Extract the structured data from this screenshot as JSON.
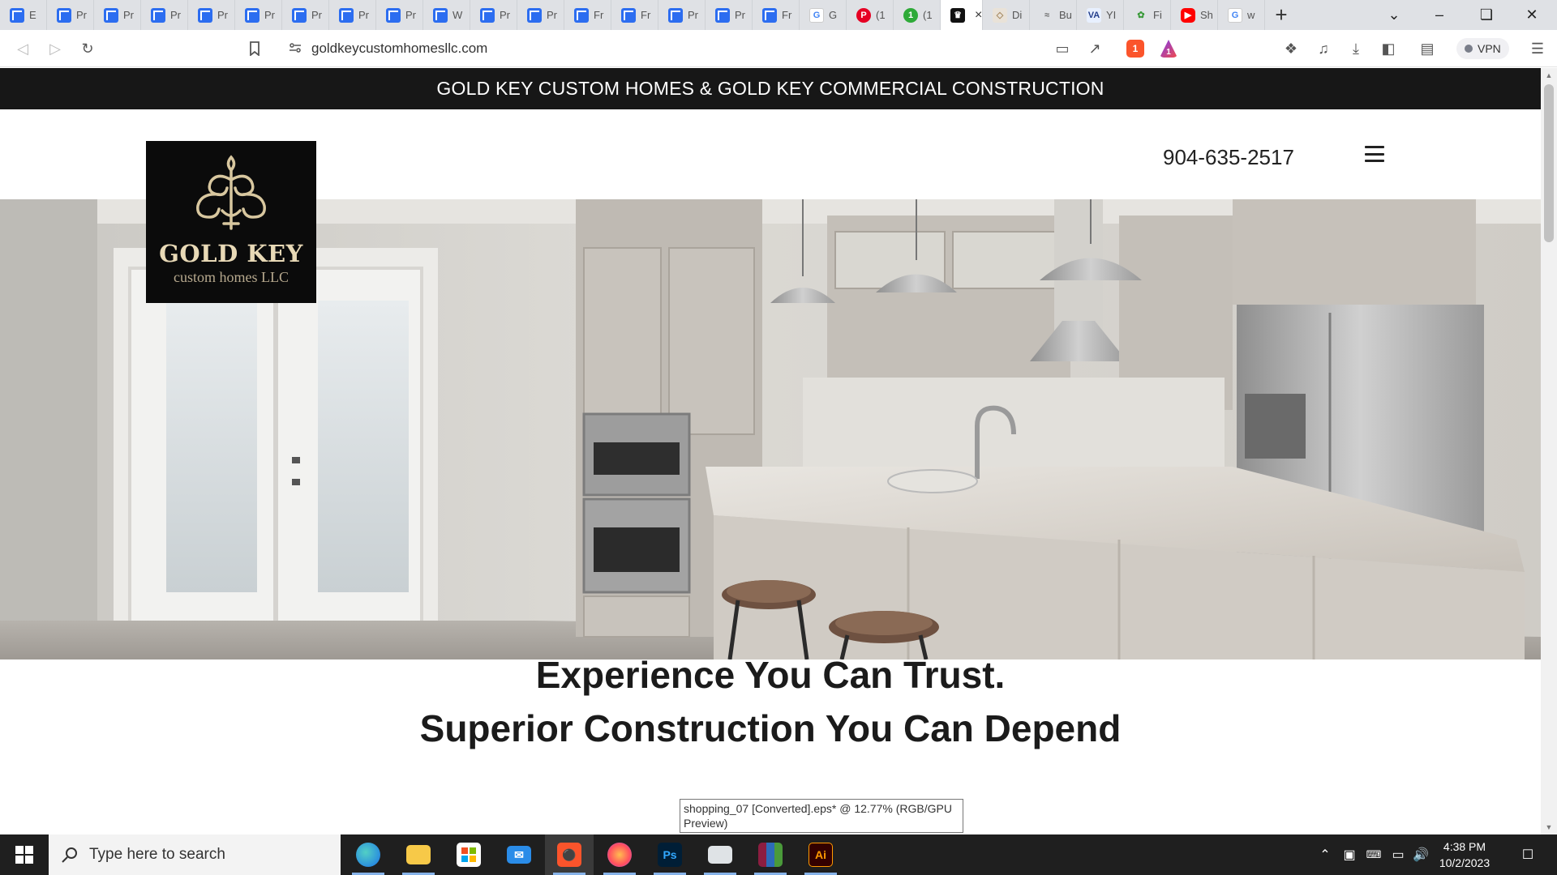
{
  "browser": {
    "tabs": [
      {
        "icon": "f",
        "label": "E"
      },
      {
        "icon": "f",
        "label": "Pr"
      },
      {
        "icon": "f",
        "label": "Pr"
      },
      {
        "icon": "f",
        "label": "Pr"
      },
      {
        "icon": "f",
        "label": "Pr"
      },
      {
        "icon": "f",
        "label": "Pr"
      },
      {
        "icon": "f",
        "label": "Pr"
      },
      {
        "icon": "f",
        "label": "Pr"
      },
      {
        "icon": "f",
        "label": "Pr"
      },
      {
        "icon": "f",
        "label": "W"
      },
      {
        "icon": "f",
        "label": "Pr"
      },
      {
        "icon": "f",
        "label": "Pr"
      },
      {
        "icon": "f",
        "label": "Fr"
      },
      {
        "icon": "f",
        "label": "Fr"
      },
      {
        "icon": "f",
        "label": "Pr"
      },
      {
        "icon": "f",
        "label": "Pr"
      },
      {
        "icon": "f",
        "label": "Fr"
      },
      {
        "icon": "g",
        "label": "G"
      },
      {
        "icon": "p",
        "label": "(1"
      },
      {
        "icon": "n1",
        "label": "(1"
      },
      {
        "icon": "gk",
        "label": "",
        "active": true
      },
      {
        "icon": "di",
        "label": "Di"
      },
      {
        "icon": "bu",
        "label": "Bu"
      },
      {
        "icon": "va",
        "label": "YI"
      },
      {
        "icon": "fi",
        "label": "Fi"
      },
      {
        "icon": "yt",
        "label": "Sh"
      },
      {
        "icon": "g",
        "label": "w"
      }
    ],
    "new_tab_symbol": "+",
    "url": "goldkeycustomhomesllc.com",
    "vpn_label": "VPN",
    "brave_shield_count": "1",
    "brave_rewards_count": "1"
  },
  "site": {
    "banner": "GOLD KEY CUSTOM HOMES & GOLD KEY COMMERCIAL CONSTRUCTION",
    "logo_name": "GOLD KEY",
    "logo_sub": "custom homes LLC",
    "phone": "904-635-2517",
    "headline_1": "Experience You Can Trust.",
    "headline_2": "Superior Construction You Can Depend"
  },
  "tooltip": "shopping_07 [Converted].eps* @ 12.77% (RGB/GPU Preview)",
  "taskbar": {
    "search_placeholder": "Type here to search",
    "time": "4:38 PM",
    "date": "10/2/2023"
  },
  "colors": {
    "banner_bg": "#171717",
    "logo_gold": "#e8d9b6",
    "taskbar_bg": "#1f1f1f"
  }
}
